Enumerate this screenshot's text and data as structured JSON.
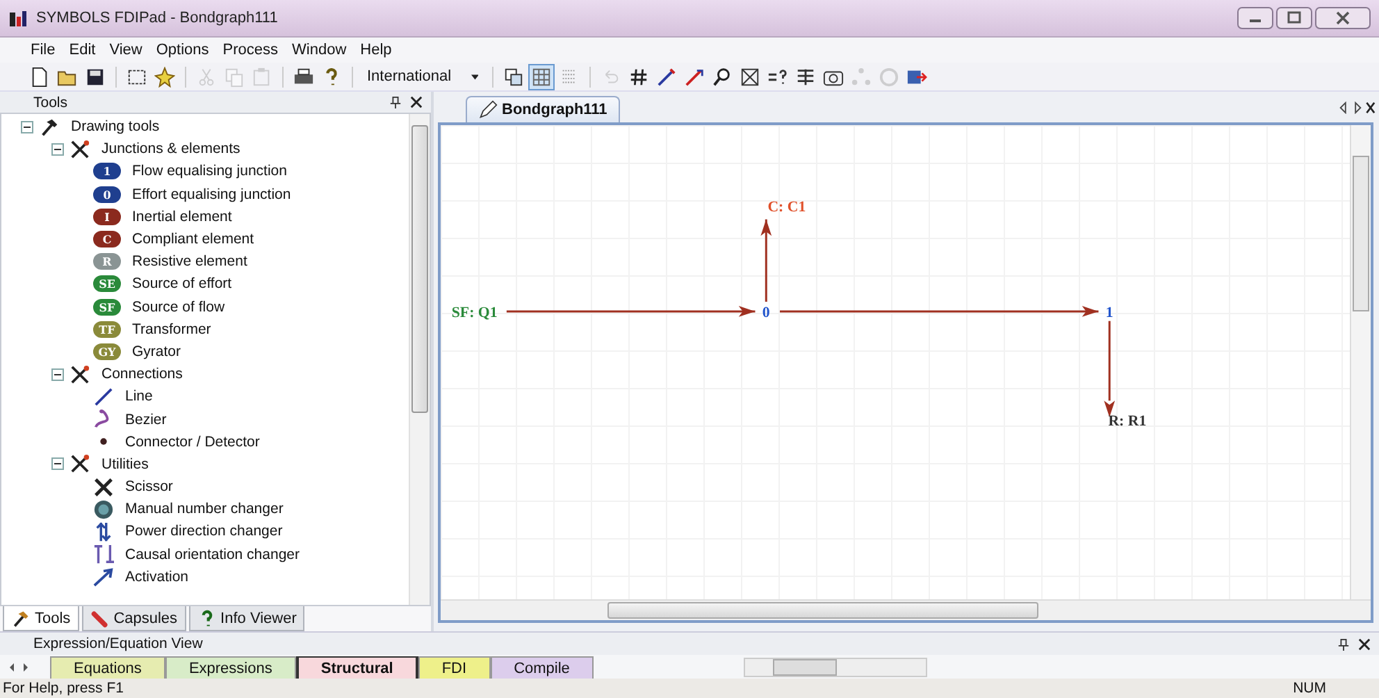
{
  "window": {
    "title": "SYMBOLS FDIPad - Bondgraph111"
  },
  "menu": [
    "File",
    "Edit",
    "View",
    "Options",
    "Process",
    "Window",
    "Help"
  ],
  "toolbar": {
    "buttons": [
      {
        "kind": "new",
        "disabled": false
      },
      {
        "kind": "open",
        "disabled": false
      },
      {
        "kind": "save",
        "disabled": false
      },
      {
        "kind": "select",
        "disabled": false
      },
      {
        "kind": "magic",
        "disabled": false
      },
      {
        "kind": "cut",
        "disabled": true
      },
      {
        "kind": "copy",
        "disabled": true
      },
      {
        "kind": "paste",
        "disabled": true
      },
      {
        "kind": "print",
        "disabled": false
      },
      {
        "kind": "help",
        "disabled": false
      }
    ],
    "combo": {
      "value": "International"
    },
    "toggles": [
      {
        "kind": "layers",
        "selected": false
      },
      {
        "kind": "grid",
        "selected": true
      },
      {
        "kind": "dots",
        "selected": false
      }
    ],
    "tools": [
      {
        "kind": "undo",
        "disabled": true
      },
      {
        "kind": "hash",
        "disabled": false
      },
      {
        "kind": "pen",
        "disabled": false
      },
      {
        "kind": "pen2",
        "disabled": false
      },
      {
        "kind": "zoom",
        "disabled": false
      },
      {
        "kind": "boxx",
        "disabled": false
      },
      {
        "kind": "equals",
        "disabled": false
      },
      {
        "kind": "list",
        "disabled": false
      },
      {
        "kind": "camera",
        "disabled": false
      },
      {
        "kind": "nodes",
        "disabled": true
      },
      {
        "kind": "circle",
        "disabled": true
      },
      {
        "kind": "export",
        "disabled": false
      }
    ]
  },
  "tools_panel": {
    "title": "Tools",
    "tree": [
      {
        "label": "Drawing tools",
        "expanded": true,
        "children": [
          {
            "label": "Junctions & elements",
            "expanded": true,
            "children": [
              {
                "label": "Flow equalising junction",
                "kind": "badge",
                "badge": "1",
                "color": "#1f3f8f"
              },
              {
                "label": "Effort equalising junction",
                "kind": "badge",
                "badge": "0",
                "color": "#1f3f8f"
              },
              {
                "label": "Inertial element",
                "kind": "badge",
                "badge": "I",
                "color": "#8b2a1e"
              },
              {
                "label": "Compliant element",
                "kind": "badge",
                "badge": "C",
                "color": "#8b2a1e"
              },
              {
                "label": "Resistive element",
                "kind": "badge",
                "badge": "R",
                "color": "#8a9494"
              },
              {
                "label": "Source of effort",
                "kind": "badge",
                "badge": "SE",
                "color": "#2a8a3a"
              },
              {
                "label": "Source of flow",
                "kind": "badge",
                "badge": "SF",
                "color": "#2a8a3a"
              },
              {
                "label": "Transformer",
                "kind": "badge",
                "badge": "TF",
                "color": "#8a8a3a"
              },
              {
                "label": "Gyrator",
                "kind": "badge",
                "badge": "GY",
                "color": "#8a8a3a"
              }
            ]
          },
          {
            "label": "Connections",
            "expanded": true,
            "children": [
              {
                "label": "Line",
                "kind": "line"
              },
              {
                "label": "Bezier",
                "kind": "bezier"
              },
              {
                "label": "Connector / Detector",
                "kind": "dot"
              }
            ]
          },
          {
            "label": "Utilities",
            "expanded": true,
            "children": [
              {
                "label": "Scissor",
                "kind": "scissor"
              },
              {
                "label": "Manual number changer",
                "kind": "target"
              },
              {
                "label": "Power direction changer",
                "kind": "power"
              },
              {
                "label": "Causal orientation changer",
                "kind": "causal"
              },
              {
                "label": "Activation",
                "kind": "activation"
              }
            ]
          }
        ]
      }
    ],
    "tabs": [
      {
        "label": "Tools",
        "kind": "hammer",
        "selected": true
      },
      {
        "label": "Capsules",
        "kind": "capsule",
        "selected": false
      },
      {
        "label": "Info Viewer",
        "kind": "info",
        "selected": false
      }
    ]
  },
  "document": {
    "tab": "Bondgraph111",
    "diagram": {
      "nodes": [
        {
          "label": "SF: Q1",
          "color": "#2a8a3a"
        },
        {
          "label": "0",
          "color": "#2255cc"
        },
        {
          "label": "1",
          "color": "#2255cc"
        },
        {
          "label": "C: C1",
          "color": "#e0502a"
        },
        {
          "label": "R: R1",
          "color": "#333333"
        }
      ]
    }
  },
  "bottom_panel": {
    "title": "Expression/Equation View",
    "tabs": [
      {
        "label": "Equations",
        "color": "#e6ecb0",
        "selected": false
      },
      {
        "label": "Expressions",
        "color": "#d8ecc8",
        "selected": false
      },
      {
        "label": "Structural",
        "color": "#f8d8dc",
        "selected": true
      },
      {
        "label": "FDI",
        "color": "#eef08a",
        "selected": false
      },
      {
        "label": "Compile",
        "color": "#dccdec",
        "selected": false
      }
    ]
  },
  "status_bar": {
    "text": "For Help, press F1",
    "indicator": "NUM"
  }
}
